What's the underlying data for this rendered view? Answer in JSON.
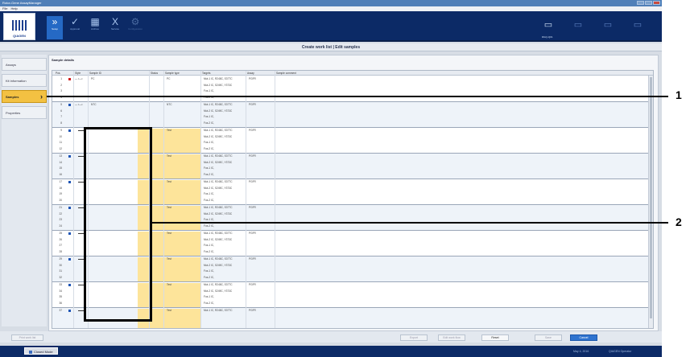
{
  "window": {
    "title": "Rotor-Gene AssayManager"
  },
  "menu": {
    "items": [
      "File",
      "Help"
    ]
  },
  "logo": {
    "text": "QIAGEN"
  },
  "tabs": [
    {
      "label": "Setup",
      "icon": "chevrons-icon",
      "state": "active"
    },
    {
      "label": "Approval",
      "icon": "check-clipboard-icon",
      "state": "normal"
    },
    {
      "label": "Archive",
      "icon": "archive-grid-icon",
      "state": "normal"
    },
    {
      "label": "Service",
      "icon": "service-xt-icon",
      "state": "normal"
    },
    {
      "label": "Configuration",
      "icon": "configuration-icon",
      "state": "disabled"
    }
  ],
  "right_toolbar": {
    "first_label": "RGQ-Q01",
    "icons": [
      "cycler-icon",
      "cycler-icon",
      "cycler-icon",
      "cycler-icon"
    ]
  },
  "header": {
    "title": "Create work list | Edit samples"
  },
  "sidebar": {
    "items": [
      {
        "label": "Assays",
        "active": false
      },
      {
        "label": "Kit information",
        "active": false
      },
      {
        "label": "Samples",
        "active": true
      },
      {
        "label": "Properties",
        "active": false
      }
    ]
  },
  "content": {
    "title": "Sample details"
  },
  "table": {
    "columns": [
      "Pos.",
      "Style",
      "Sample ID",
      "Status",
      "Sample type",
      "Targets",
      "Assay",
      "Sample comment"
    ],
    "groups": [
      {
        "positions": [
          "1",
          "2",
          "3",
          "4"
        ],
        "flag": "red",
        "style": "— •—•",
        "sample_id": "PC",
        "type": "PC",
        "assay": "PGFR",
        "targets": [
          "Mut-1 IC, R248C, S37TC",
          "Mut-2 IC, S249C, Y373C",
          "Fus-1 IC,",
          "Fus-2 IC,"
        ],
        "editable": false
      },
      {
        "positions": [
          "5",
          "6",
          "7",
          "8"
        ],
        "flag": "blue",
        "style": "— •—•",
        "sample_id": "NTC",
        "type": "NTC",
        "assay": "PGFR",
        "targets": [
          "Mut-1 IC, R248C, S37TC",
          "Mut-2 IC, S249C, Y373C",
          "Fus-1 IC,",
          "Fus-2 IC,"
        ],
        "editable": false
      },
      {
        "positions": [
          "9",
          "10",
          "11",
          "12"
        ],
        "flag": "blue",
        "style": "",
        "sample_id": "",
        "type": "Test",
        "assay": "PGFR",
        "targets": [
          "Mut-1 IC, R248C, S37TC",
          "Mut-2 IC, S249C, Y373C",
          "Fus-1 IC,",
          "Fus-2 IC,"
        ],
        "editable": true
      },
      {
        "positions": [
          "13",
          "14",
          "15",
          "16"
        ],
        "flag": "blue",
        "style": "",
        "sample_id": "",
        "type": "Test",
        "assay": "PGFR",
        "targets": [
          "Mut-1 IC, R248C, S37TC",
          "Mut-2 IC, S249C, Y373C",
          "Fus-1 IC,",
          "Fus-2 IC,"
        ],
        "editable": true
      },
      {
        "positions": [
          "17",
          "18",
          "19",
          "20"
        ],
        "flag": "blue",
        "style": "",
        "sample_id": "",
        "type": "Test",
        "assay": "PGFR",
        "targets": [
          "Mut-1 IC, R248C, S37TC",
          "Mut-2 IC, S249C, Y373C",
          "Fus-1 IC,",
          "Fus-2 IC,"
        ],
        "editable": true
      },
      {
        "positions": [
          "21",
          "22",
          "23",
          "24"
        ],
        "flag": "blue",
        "style": "",
        "sample_id": "",
        "type": "Test",
        "assay": "PGFR",
        "targets": [
          "Mut-1 IC, R248C, S37TC",
          "Mut-2 IC, S249C, Y373C",
          "Fus-1 IC,",
          "Fus-2 IC,"
        ],
        "editable": true
      },
      {
        "positions": [
          "25",
          "26",
          "27",
          "28"
        ],
        "flag": "blue",
        "style": "",
        "sample_id": "",
        "type": "Test",
        "assay": "PGFR",
        "targets": [
          "Mut-1 IC, R248C, S37TC",
          "Mut-2 IC, S249C, Y373C",
          "Fus-1 IC,",
          "Fus-2 IC,"
        ],
        "editable": true
      },
      {
        "positions": [
          "29",
          "30",
          "31",
          "32"
        ],
        "flag": "blue",
        "style": "",
        "sample_id": "",
        "type": "Test",
        "assay": "PGFR",
        "targets": [
          "Mut-1 IC, R248C, S37TC",
          "Mut-2 IC, S249C, Y373C",
          "Fus-1 IC,",
          "Fus-2 IC,"
        ],
        "editable": true
      },
      {
        "positions": [
          "33",
          "34",
          "35",
          "36"
        ],
        "flag": "blue",
        "style": "",
        "sample_id": "",
        "type": "Test",
        "assay": "PGFR",
        "targets": [
          "Mut-1 IC, R248C, S37TC",
          "Mut-2 IC, S249C, Y373C",
          "Fus-1 IC,",
          "Fus-2 IC,"
        ],
        "editable": true
      },
      {
        "positions": [
          "37"
        ],
        "flag": "blue",
        "style": "",
        "sample_id": "",
        "type": "Test",
        "assay": "PGFR",
        "targets": [
          "Mut-1 IC, R248C, S37TC"
        ],
        "editable": true
      }
    ]
  },
  "bottom": {
    "left_button": "Print work list",
    "buttons": [
      "Export",
      "Edit work flow",
      "Reset",
      "Save",
      "Cancel"
    ]
  },
  "status": {
    "mode_button": "Closed Mode",
    "date": "May 4, 2016",
    "user": "QIAGEN Operator"
  },
  "callouts": [
    {
      "label": "1"
    },
    {
      "label": "2"
    }
  ]
}
